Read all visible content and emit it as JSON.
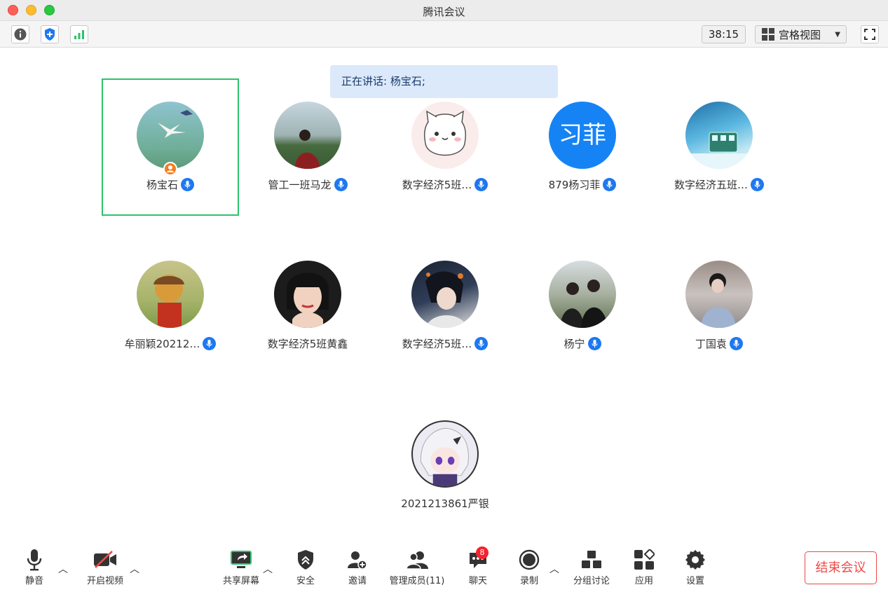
{
  "window": {
    "title": "腾讯会议"
  },
  "toolbar": {
    "timer": "38:15",
    "view_label": "宫格视图",
    "info_icon": "info-icon",
    "security_icon": "shield-plus-icon",
    "signal_icon": "signal-bars-icon",
    "fullscreen_icon": "fullscreen-icon"
  },
  "speaking": {
    "text": "正在讲话: 杨宝石;"
  },
  "participants": [
    {
      "name": "杨宝石",
      "mic": true,
      "host": true,
      "active": true
    },
    {
      "name": "管工一班马龙",
      "mic": true
    },
    {
      "name": "数字经济5班…",
      "mic": true
    },
    {
      "name": "879杨习菲",
      "mic": true,
      "avatar_text": "习菲"
    },
    {
      "name": "数字经济五班…",
      "mic": true
    },
    {
      "name": "牟丽颖20212…",
      "mic": true
    },
    {
      "name": "数字经济5班黄鑫",
      "mic": false
    },
    {
      "name": "数字经济5班…",
      "mic": true
    },
    {
      "name": "杨宁",
      "mic": true
    },
    {
      "name": "丁国袁",
      "mic": true
    },
    {
      "name": "2021213861严银",
      "mic": false
    }
  ],
  "bottombar": {
    "mute": "静音",
    "video": "开启视频",
    "share": "共享屏幕",
    "security": "安全",
    "invite": "邀请",
    "members": "管理成员(11)",
    "chat": "聊天",
    "chat_badge": "8",
    "record": "录制",
    "breakout": "分组讨论",
    "apps": "应用",
    "settings": "设置",
    "end": "结束会议"
  },
  "colors": {
    "accent": "#1e78f0",
    "active_border": "#2cc36b",
    "end": "#f04848",
    "badge": "#f5222d"
  }
}
